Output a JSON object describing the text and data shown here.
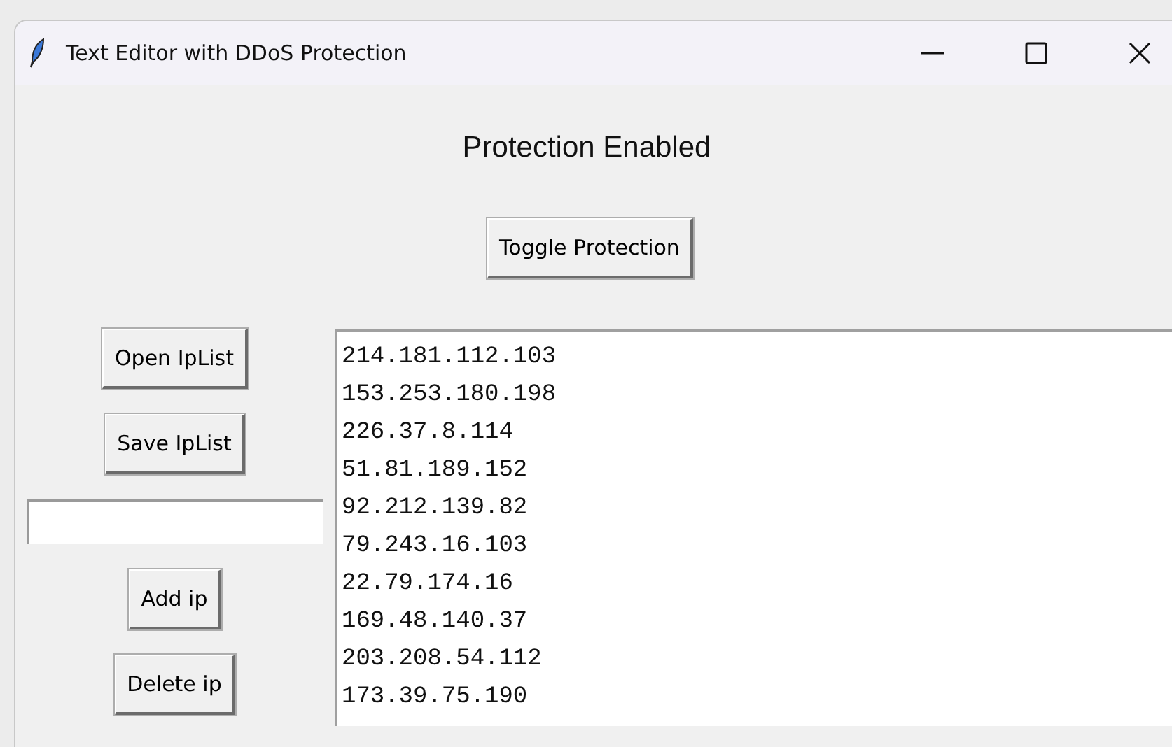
{
  "window": {
    "title": "Text Editor with DDoS Protection"
  },
  "status_label": "Protection Enabled",
  "toggle_button": "Toggle Protection",
  "sidebar": {
    "open_button": "Open IpList",
    "save_button": "Save IpList",
    "add_button": "Add ip",
    "delete_button": "Delete ip"
  },
  "ip_list": [
    "214.181.112.103",
    "153.253.180.198",
    "226.37.8.114",
    "51.81.189.152",
    "92.212.139.82",
    "79.243.16.103",
    "22.79.174.16",
    "169.48.140.37",
    "203.208.54.112",
    "173.39.75.190"
  ]
}
